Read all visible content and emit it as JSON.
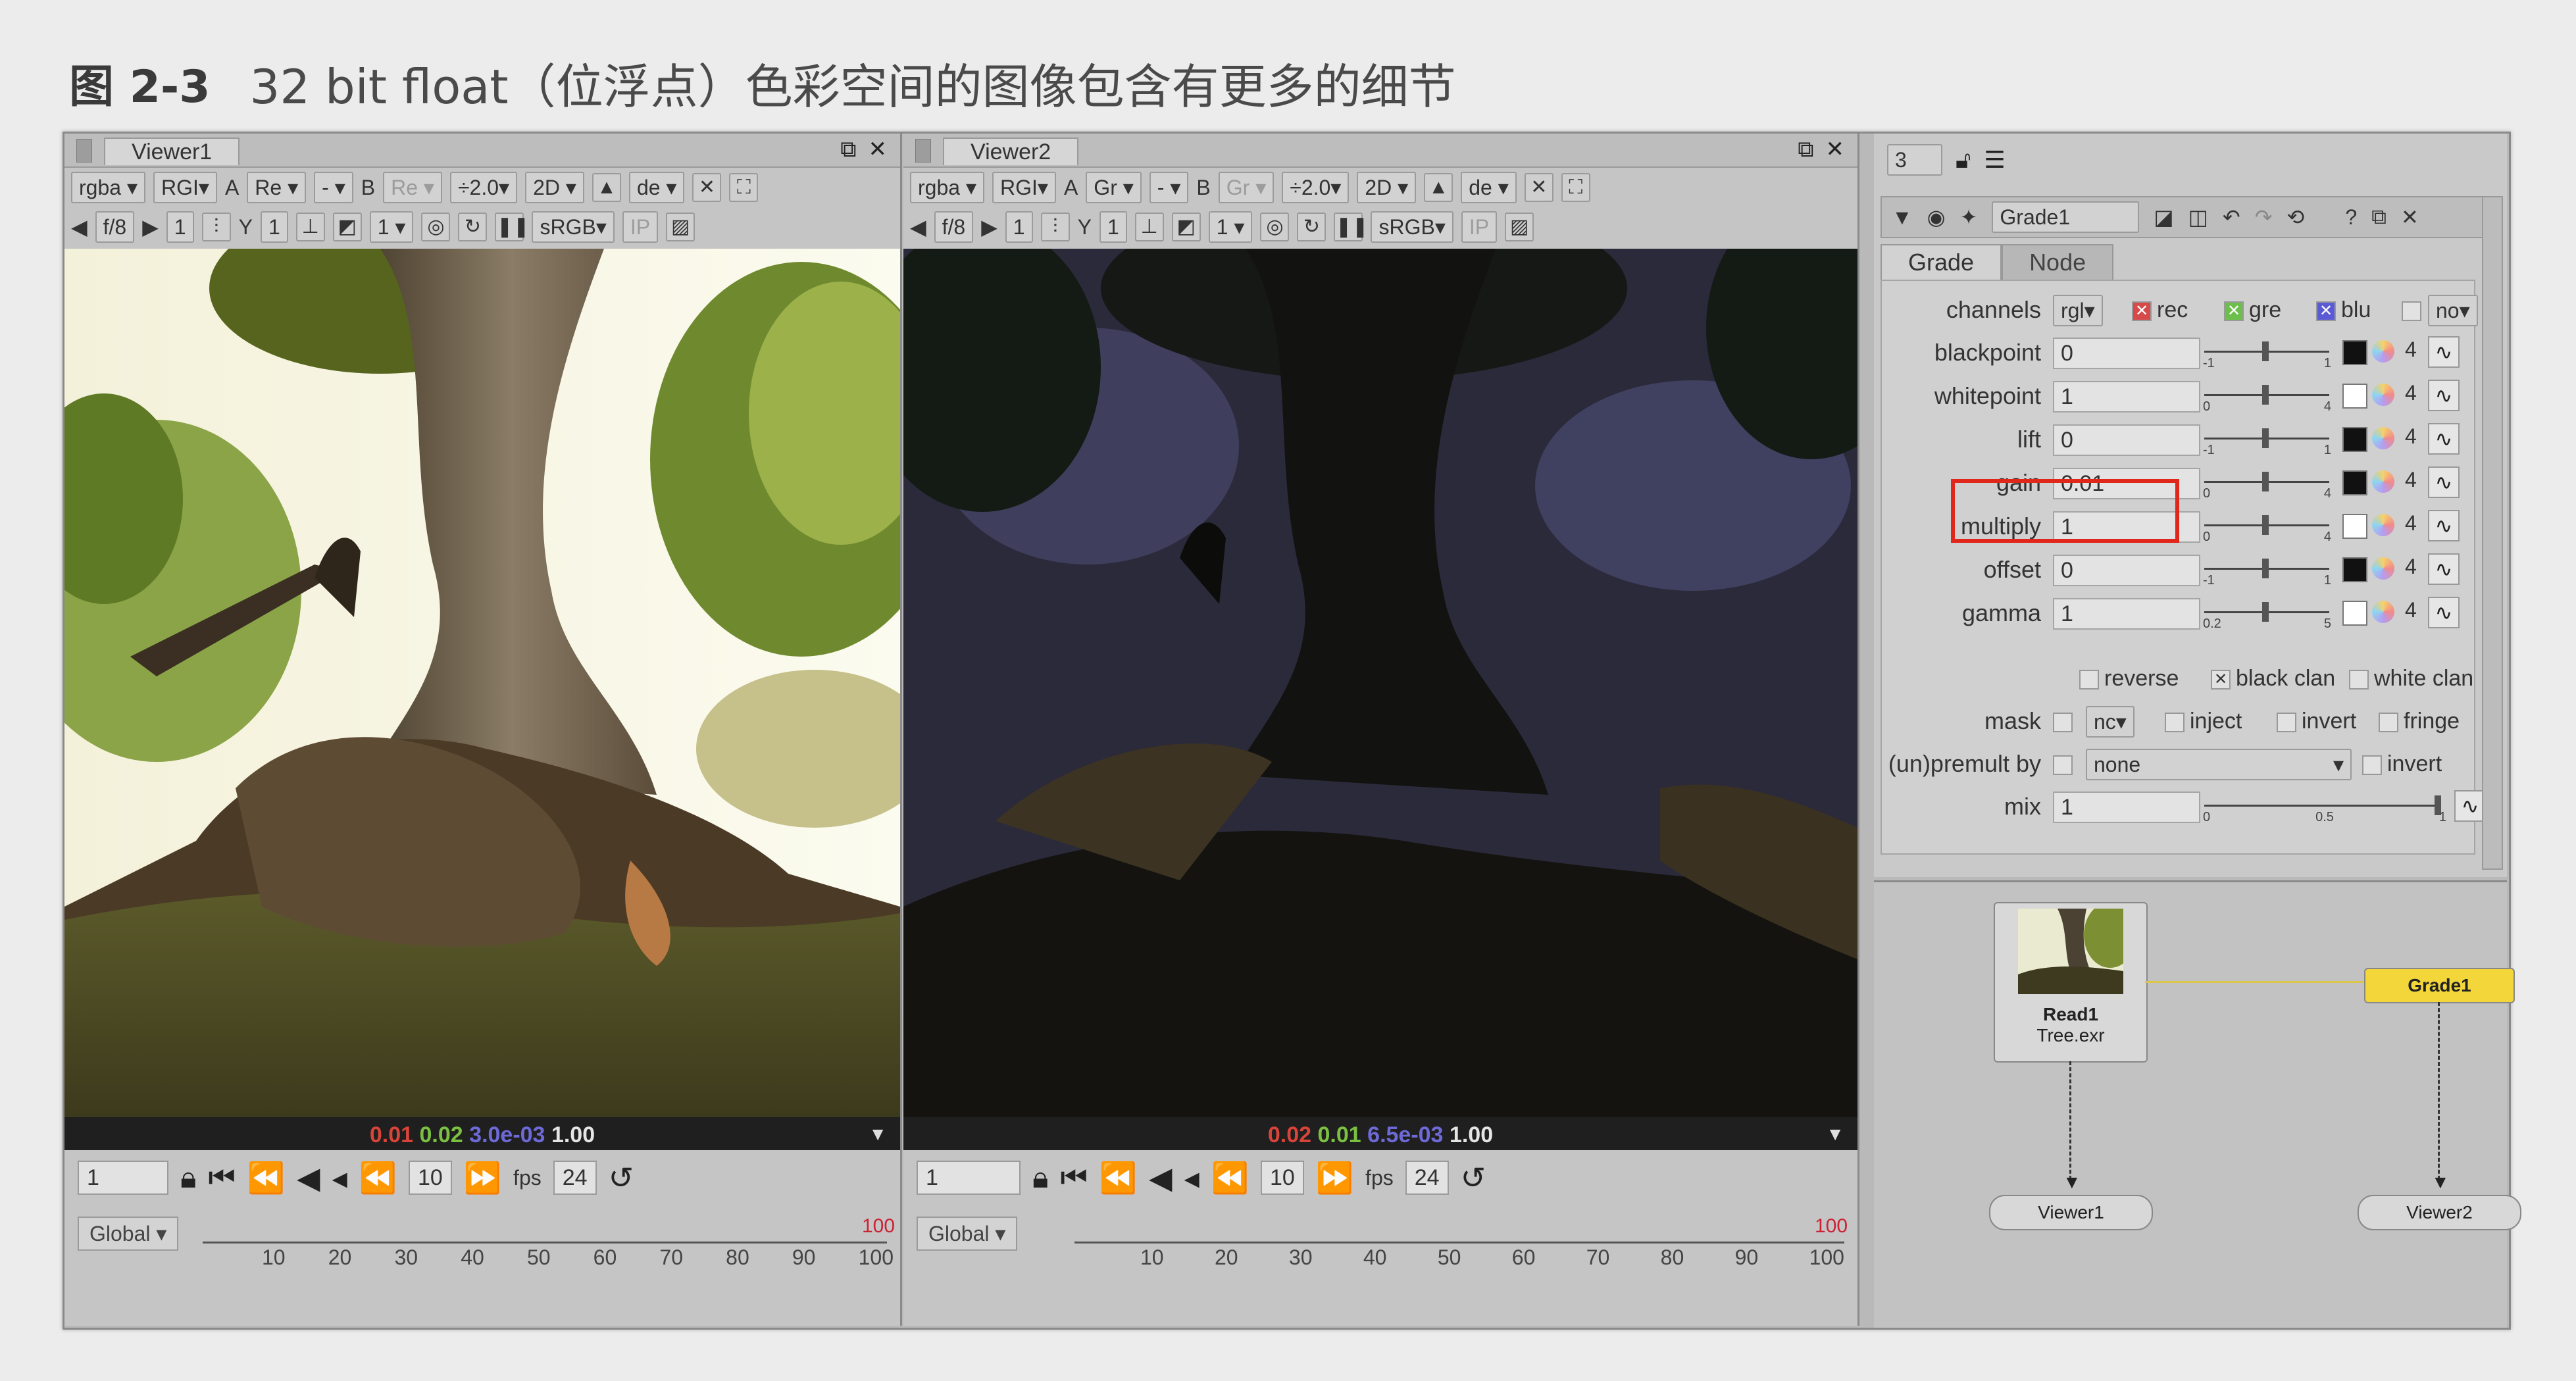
{
  "caption": {
    "number": "图 2-3",
    "text": "32 bit float（位浮点）色彩空间的图像包含有更多的细节"
  },
  "viewers": [
    {
      "tab": "Viewer1",
      "toolbar1": {
        "channels": "rgba",
        "lut": "RGI",
        "a_channel": "A",
        "a_value": "Re",
        "dash": "-",
        "b_label": "B",
        "b_value": "Re",
        "gain": "÷2.0",
        "view": "2D",
        "proxy": "de"
      },
      "toolbar2": {
        "fstop": "f/8",
        "frame": "1",
        "y_label": "Y",
        "y_value": "1",
        "input": "1",
        "colorspace": "sRGB",
        "ip": "IP"
      },
      "info": {
        "r": "0.01",
        "g": "0.02",
        "b": "3.0e-03",
        "a": "1.00"
      },
      "transport": {
        "frame": "1",
        "step": "10",
        "fps_label": "fps",
        "fps": "24"
      },
      "timeline": {
        "range": "Global",
        "end": "100",
        "ticks": [
          "10",
          "20",
          "30",
          "40",
          "50",
          "60",
          "70",
          "80",
          "90",
          "100"
        ]
      }
    },
    {
      "tab": "Viewer2",
      "toolbar1": {
        "channels": "rgba",
        "lut": "RGI",
        "a_channel": "A",
        "a_value": "Gr",
        "dash": "-",
        "b_label": "B",
        "b_value": "Gr",
        "gain": "÷2.0",
        "view": "2D",
        "proxy": "de"
      },
      "toolbar2": {
        "fstop": "f/8",
        "frame": "1",
        "y_label": "Y",
        "y_value": "1",
        "input": "1",
        "colorspace": "sRGB",
        "ip": "IP"
      },
      "info": {
        "r": "0.02",
        "g": "0.01",
        "b": "6.5e-03",
        "a": "1.00"
      },
      "transport": {
        "frame": "1",
        "step": "10",
        "fps_label": "fps",
        "fps": "24"
      },
      "timeline": {
        "range": "Global",
        "end": "100",
        "ticks": [
          "10",
          "20",
          "30",
          "40",
          "50",
          "60",
          "70",
          "80",
          "90",
          "100"
        ]
      }
    }
  ],
  "properties": {
    "count": "3",
    "node_name": "Grade1",
    "tabs": [
      "Grade",
      "Node"
    ],
    "channels": {
      "label": "channels",
      "value": "rgl",
      "red": "rec",
      "green": "gre",
      "blue": "blu",
      "alpha_value": "no"
    },
    "rows": [
      {
        "label": "blackpoint",
        "value": "0",
        "min": "-1",
        "max": "1",
        "swatch": "#111111"
      },
      {
        "label": "whitepoint",
        "value": "1",
        "min": "0",
        "max": "4",
        "swatch": "#ffffff"
      },
      {
        "label": "lift",
        "value": "0",
        "min": "-1",
        "max": "1",
        "swatch": "#111111"
      },
      {
        "label": "gain",
        "value": "0.01",
        "min": "0",
        "max": "4",
        "swatch": "#111111"
      },
      {
        "label": "multiply",
        "value": "1",
        "min": "0",
        "max": "4",
        "swatch": "#ffffff"
      },
      {
        "label": "offset",
        "value": "0",
        "min": "-1",
        "max": "1",
        "swatch": "#111111"
      },
      {
        "label": "gamma",
        "value": "1",
        "min": "0.2",
        "max": "5",
        "swatch": "#ffffff"
      }
    ],
    "four": "4",
    "reverse": "reverse",
    "black_clamp": "black clan",
    "white_clamp": "white clan",
    "mask": {
      "label": "mask",
      "value": "nc",
      "inject": "inject",
      "invert": "invert",
      "fringe": "fringe"
    },
    "premult": {
      "label": "(un)premult by",
      "value": "none",
      "invert": "invert"
    },
    "mix": {
      "label": "mix",
      "value": "1",
      "min": "0",
      "mid": "0.5",
      "max": "1"
    }
  },
  "nodegraph": {
    "read_node": {
      "name": "Read1",
      "file": "Tree.exr"
    },
    "grade_node": "Grade1",
    "viewer1": "Viewer1",
    "viewer2": "Viewer2"
  },
  "colors": {
    "highlight": "#e1261c",
    "grade_node": "#f2d63a",
    "info_red": "#d8443a",
    "info_green": "#7bc043",
    "info_blue": "#6d6ad8"
  }
}
